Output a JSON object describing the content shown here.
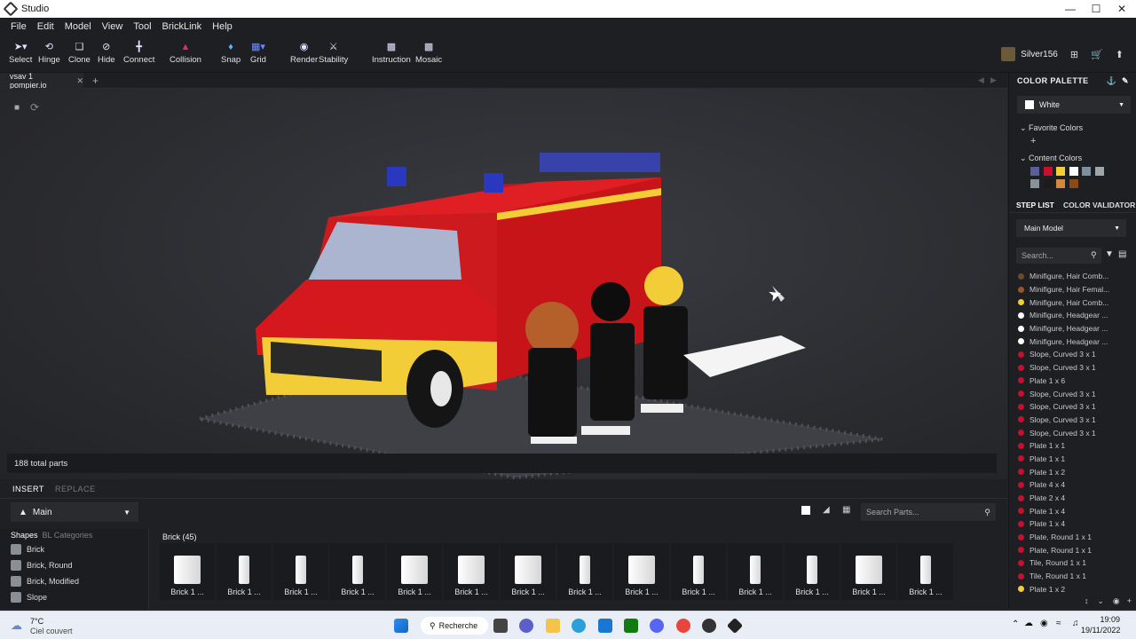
{
  "window": {
    "title": "Studio"
  },
  "menu": [
    "File",
    "Edit",
    "Model",
    "View",
    "Tool",
    "BrickLink",
    "Help"
  ],
  "toolbar": {
    "tools": [
      {
        "name": "select",
        "label": "Select",
        "icon": "cursor-icon"
      },
      {
        "name": "hinge",
        "label": "Hinge",
        "icon": "hinge-icon"
      },
      {
        "name": "clone",
        "label": "Clone",
        "icon": "clone-icon"
      },
      {
        "name": "hide",
        "label": "Hide",
        "icon": "eye-slash-icon"
      },
      {
        "name": "connect",
        "label": "Connect",
        "icon": "connect-icon"
      },
      {
        "name": "collision",
        "label": "Collision",
        "icon": "collision-icon"
      },
      {
        "name": "snap",
        "label": "Snap",
        "icon": "snap-icon"
      },
      {
        "name": "grid",
        "label": "Grid",
        "icon": "grid-icon"
      },
      {
        "name": "render",
        "label": "Render",
        "icon": "camera-icon"
      },
      {
        "name": "stability",
        "label": "Stability",
        "icon": "stability-icon"
      },
      {
        "name": "instruction",
        "label": "Instruction",
        "icon": "instruction-icon"
      },
      {
        "name": "mosaic",
        "label": "Mosaic",
        "icon": "mosaic-icon"
      }
    ],
    "username": "Silver156"
  },
  "tabs": [
    {
      "label": "vsav 1 pompier.io"
    }
  ],
  "viewport": {
    "total_parts": "188 total parts"
  },
  "bottom": {
    "tab_insert": "INSERT",
    "tab_replace": "REPLACE",
    "palette_select": "Main",
    "search_placeholder": "Search Parts...",
    "sub_tab_shapes": "Shapes",
    "sub_tab_bl": "BL Categories",
    "categories": [
      "Brick",
      "Brick, Round",
      "Brick, Modified",
      "Slope"
    ],
    "group_title": "Brick (45)",
    "bricks": [
      "Brick 1 ...",
      "Brick 1 ...",
      "Brick 1 ...",
      "Brick 1 ...",
      "Brick 1 ...",
      "Brick 1 ...",
      "Brick 1 ...",
      "Brick 1 ...",
      "Brick 1 ...",
      "Brick 1 ...",
      "Brick 1 ...",
      "Brick 1 ...",
      "Brick 1 ...",
      "Brick 1 ..."
    ]
  },
  "color_palette": {
    "title": "COLOR PALETTE",
    "selected_color": "White",
    "favorite_title": "Favorite Colors",
    "content_title": "Content Colors",
    "content_colors": [
      "#5a5f9c",
      "#c8102e",
      "#f2cd37",
      "#ffffff",
      "#7c8f9c",
      "#a0a5a9",
      "#8a9299",
      "#1b1b1b",
      "#d4883c",
      "#8b4a14"
    ]
  },
  "step_list": {
    "tab_step": "STEP LIST",
    "tab_validator": "COLOR VALIDATOR",
    "model_select": "Main Model",
    "search_placeholder": "Search...",
    "items": [
      {
        "label": "Minifigure, Hair Comb...",
        "color": "#6a4a2c"
      },
      {
        "label": "Minifigure, Hair Femal...",
        "color": "#a0522d"
      },
      {
        "label": "Minifigure, Hair Comb...",
        "color": "#f2cd37"
      },
      {
        "label": "Minifigure, Headgear ...",
        "color": "#ffffff"
      },
      {
        "label": "Minifigure, Headgear ...",
        "color": "#ffffff"
      },
      {
        "label": "Minifigure, Headgear ...",
        "color": "#ffffff"
      },
      {
        "label": "Slope, Curved 3 x 1",
        "color": "#c8102e"
      },
      {
        "label": "Slope, Curved 3 x 1",
        "color": "#c8102e"
      },
      {
        "label": "Plate 1 x 6",
        "color": "#c8102e"
      },
      {
        "label": "Slope, Curved 3 x 1",
        "color": "#c8102e"
      },
      {
        "label": "Slope, Curved 3 x 1",
        "color": "#c8102e"
      },
      {
        "label": "Slope, Curved 3 x 1",
        "color": "#c8102e"
      },
      {
        "label": "Slope, Curved 3 x 1",
        "color": "#c8102e"
      },
      {
        "label": "Plate 1 x 1",
        "color": "#c8102e"
      },
      {
        "label": "Plate 1 x 1",
        "color": "#c8102e"
      },
      {
        "label": "Plate 1 x 2",
        "color": "#c8102e"
      },
      {
        "label": "Plate 4 x 4",
        "color": "#c8102e"
      },
      {
        "label": "Plate 2 x 4",
        "color": "#c8102e"
      },
      {
        "label": "Plate 1 x 4",
        "color": "#c8102e"
      },
      {
        "label": "Plate 1 x 4",
        "color": "#c8102e"
      },
      {
        "label": "Plate, Round 1 x 1",
        "color": "#c8102e"
      },
      {
        "label": "Plate, Round 1 x 1",
        "color": "#c8102e"
      },
      {
        "label": "Tile, Round 1 x 1",
        "color": "#c8102e"
      },
      {
        "label": "Tile, Round 1 x 1",
        "color": "#c8102e"
      },
      {
        "label": "Plate 1 x 2",
        "color": "#f2cd37"
      }
    ]
  },
  "taskbar": {
    "weather_temp": "7°C",
    "weather_desc": "Ciel couvert",
    "search_label": "Recherche",
    "time": "19:09",
    "date": "19/11/2022"
  }
}
